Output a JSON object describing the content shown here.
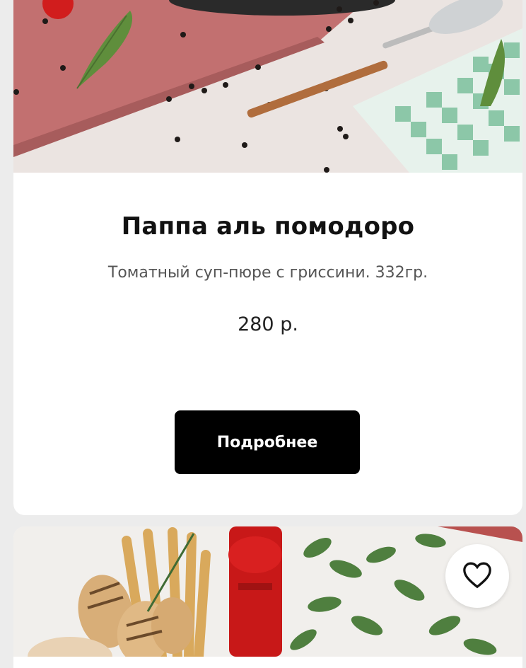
{
  "cards": [
    {
      "title": "Паппа аль помодоро",
      "description": "Томатный суп-пюре с гриссини. 332гр.",
      "price": "280 р.",
      "button_label": "Подробнее",
      "image": "soup-table-setting-photo"
    },
    {
      "image": "bread-sticks-and-herbs-photo",
      "favorite_icon": "heart-outline-icon"
    }
  ],
  "colors": {
    "button_bg": "#000000",
    "page_bg": "#ececec",
    "card_bg": "#ffffff"
  }
}
